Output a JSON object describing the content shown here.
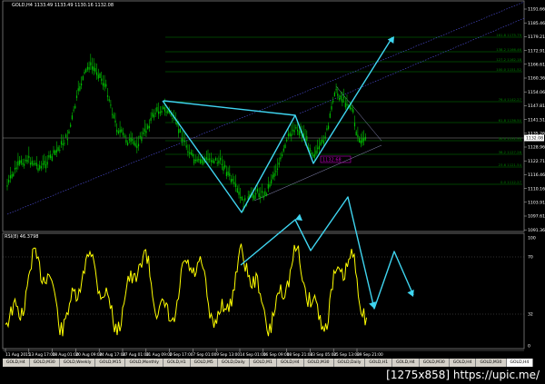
{
  "chart": {
    "header": "GOLD,H4  1133.49 1133.49 1130.16 1132.08",
    "rsi_header": "RSI(8) 46.3798",
    "price_ticks": [
      "1191.66",
      "1185.46",
      "1179.21",
      "1172.91",
      "1166.61",
      "1160.36",
      "1154.06",
      "1147.81",
      "1141.51",
      "1135.26",
      "1128.96",
      "1122.71",
      "1116.46",
      "1110.16",
      "1103.91",
      "1097.61",
      "1091.36"
    ],
    "price_line_label": "1132.08",
    "rsi_ticks": [
      "100",
      "70",
      "32",
      "0"
    ],
    "time_ticks": [
      "11 Aug 2015",
      "13 Aug 17:00",
      "18 Aug 01:00",
      "20 Aug 09:00",
      "24 Aug 17:00",
      "27 Aug 01:00",
      "31 Aug 09:00",
      "2 Sep 17:00",
      "7 Sep 01:00",
      "9 Sep 13:00",
      "14 Sep 01:00",
      "16 Sep 09:00",
      "18 Sep 21:00",
      "23 Sep 05:00",
      "25 Sep 13:00",
      "29 Sep 21:00"
    ],
    "fib_levels": [
      "161.8 1175.79",
      "138.2 1166.46",
      "127.2 1162.18",
      "100.0 1151.52",
      "76.4 1142.27",
      "61.8 1136.50",
      "50.0 1131.90",
      "38.2 1127.28",
      "23.6 1121.54",
      "0.0 1112.27"
    ],
    "annotation": "1132.68",
    "colors": {
      "candles": "#00c000",
      "rsi": "#ffff00",
      "arrows": "#3fd5f0",
      "channel": "#5050e0",
      "fib": "#008000",
      "annotation": "#c000c0"
    }
  },
  "tabs": [
    "GOLD,H4",
    "GOLD,M30",
    "GOLD,Weekly",
    "GOLD,M15",
    "GOLD,Monthly",
    "GOLD,H1",
    "GOLD,M5",
    "GOLD,Daily",
    "GOLD,M1",
    "GOLD,H4",
    "GOLD,M30",
    "GOLD,Daily",
    "GOLD,H1",
    "GOLD,H4",
    "GOLD,M30",
    "GOLD,H4",
    "GOLD,M30",
    "GOLD,H4"
  ],
  "watermark": "[1275x858] https://upic.me/"
}
